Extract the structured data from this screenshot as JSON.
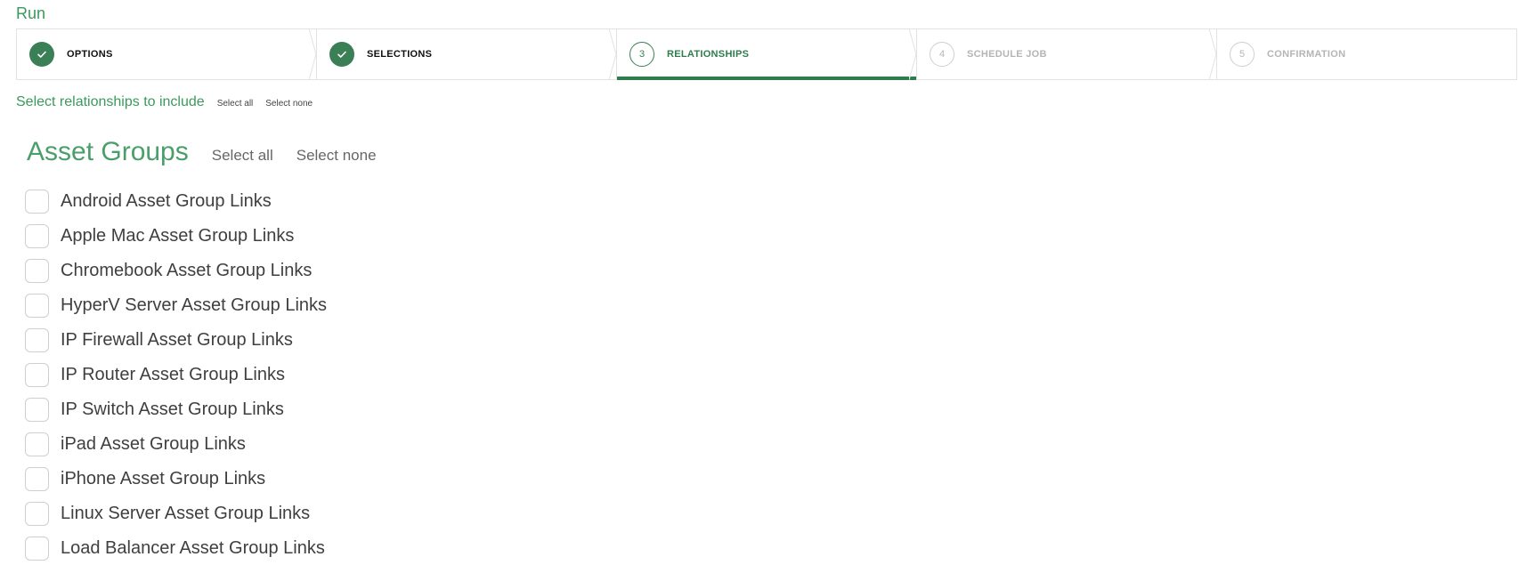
{
  "page": {
    "title": "Run"
  },
  "stepper": {
    "steps": [
      {
        "number": "1",
        "label": "OPTIONS",
        "state": "done"
      },
      {
        "number": "2",
        "label": "SELECTIONS",
        "state": "done"
      },
      {
        "number": "3",
        "label": "RELATIONSHIPS",
        "state": "current"
      },
      {
        "number": "4",
        "label": "SCHEDULE JOB",
        "state": "pending"
      },
      {
        "number": "5",
        "label": "CONFIRMATION",
        "state": "pending"
      }
    ]
  },
  "relationships": {
    "heading": "Select relationships to include",
    "select_all": "Select all",
    "select_none": "Select none"
  },
  "asset_groups": {
    "heading": "Asset Groups",
    "select_all": "Select all",
    "select_none": "Select none",
    "items": [
      {
        "label": "Android Asset Group Links",
        "checked": false
      },
      {
        "label": "Apple Mac Asset Group Links",
        "checked": false
      },
      {
        "label": "Chromebook Asset Group Links",
        "checked": false
      },
      {
        "label": "HyperV Server Asset Group Links",
        "checked": false
      },
      {
        "label": "IP Firewall Asset Group Links",
        "checked": false
      },
      {
        "label": "IP Router Asset Group Links",
        "checked": false
      },
      {
        "label": "IP Switch Asset Group Links",
        "checked": false
      },
      {
        "label": "iPad Asset Group Links",
        "checked": false
      },
      {
        "label": "iPhone Asset Group Links",
        "checked": false
      },
      {
        "label": "Linux Server Asset Group Links",
        "checked": false
      },
      {
        "label": "Load Balancer Asset Group Links",
        "checked": false
      }
    ]
  },
  "colors": {
    "accent": "#3a9a5b",
    "step_done": "#3a7f55",
    "step_pending": "#b5b5b5"
  }
}
